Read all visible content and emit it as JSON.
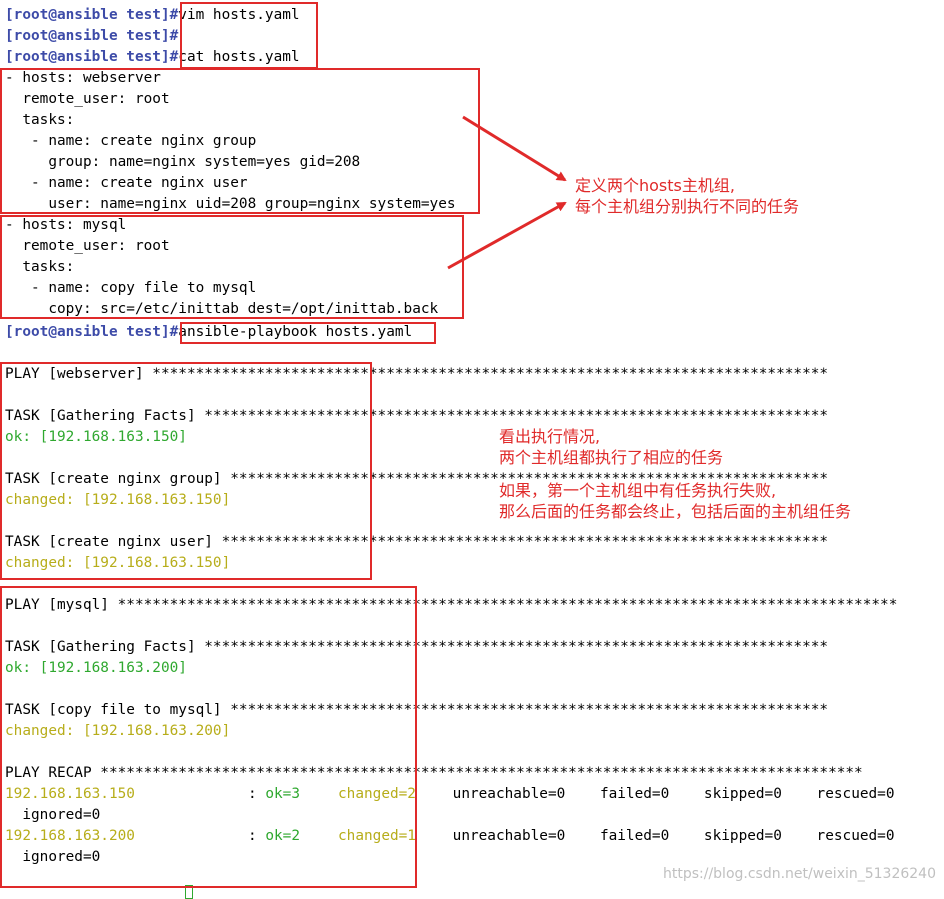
{
  "terminal": {
    "prompt": "[root@ansible test]#",
    "commands": {
      "vim": "vim hosts.yaml",
      "empty": "",
      "cat": "cat hosts.yaml",
      "run": "ansible-playbook hosts.yaml"
    },
    "yaml_lines": [
      "- hosts: webserver",
      "  remote_user: root",
      "  tasks:",
      "   - name: create nginx group",
      "     group: name=nginx system=yes gid=208",
      "   - name: create nginx user",
      "     user: name=nginx uid=208 group=nginx system=yes",
      "- hosts: mysql",
      "  remote_user: root",
      "  tasks:",
      "   - name: copy file to mysql",
      "     copy: src=/etc/inittab dest=/opt/inittab.back"
    ],
    "output": {
      "play_web": "PLAY [webserver] ******************************************************************************",
      "task_gather1": "TASK [Gathering Facts] ************************************************************************",
      "ok_150": "ok: [192.168.163.150]",
      "task_group": "TASK [create nginx group] *********************************************************************",
      "changed_150a": "changed: [192.168.163.150]",
      "task_user": "TASK [create nginx user] **********************************************************************",
      "changed_150b": "changed: [192.168.163.150]",
      "play_mysql": "PLAY [mysql] ******************************************************************************************",
      "task_gather2": "TASK [Gathering Facts] ************************************************************************",
      "ok_200": "ok: [192.168.163.200]",
      "task_copy": "TASK [copy file to mysql] *********************************************************************",
      "changed_200": "changed: [192.168.163.200]",
      "recap": "PLAY RECAP ****************************************************************************************"
    },
    "recap_rows": [
      {
        "host": "192.168.163.150",
        "sep": ": ",
        "ok": "ok=3",
        "changed": "changed=2",
        "rest": "    unreachable=0    failed=0    skipped=0    rescued=0",
        "ignored": "  ignored=0"
      },
      {
        "host": "192.168.163.200",
        "sep": ": ",
        "ok": "ok=2",
        "changed": "changed=1",
        "rest": "    unreachable=0    failed=0    skipped=0    rescued=0",
        "ignored": "  ignored=0"
      }
    ]
  },
  "annotations": {
    "note1_line1": "定义两个hosts主机组,",
    "note1_line2": "每个主机组分别执行不同的任务",
    "note2_line1": "看出执行情况,",
    "note2_line2": "两个主机组都执行了相应的任务",
    "note3_line1": "如果，第一个主机组中有任务执行失败,",
    "note3_line2": "那么后面的任务都会终止，包括后面的主机组任务"
  },
  "watermark": "https://blog.csdn.net/weixin_51326240",
  "colors": {
    "prompt": "#3d4ba8",
    "ok": "#2fa82f",
    "changed": "#b7ad1a",
    "annotation": "#e02a2a"
  }
}
